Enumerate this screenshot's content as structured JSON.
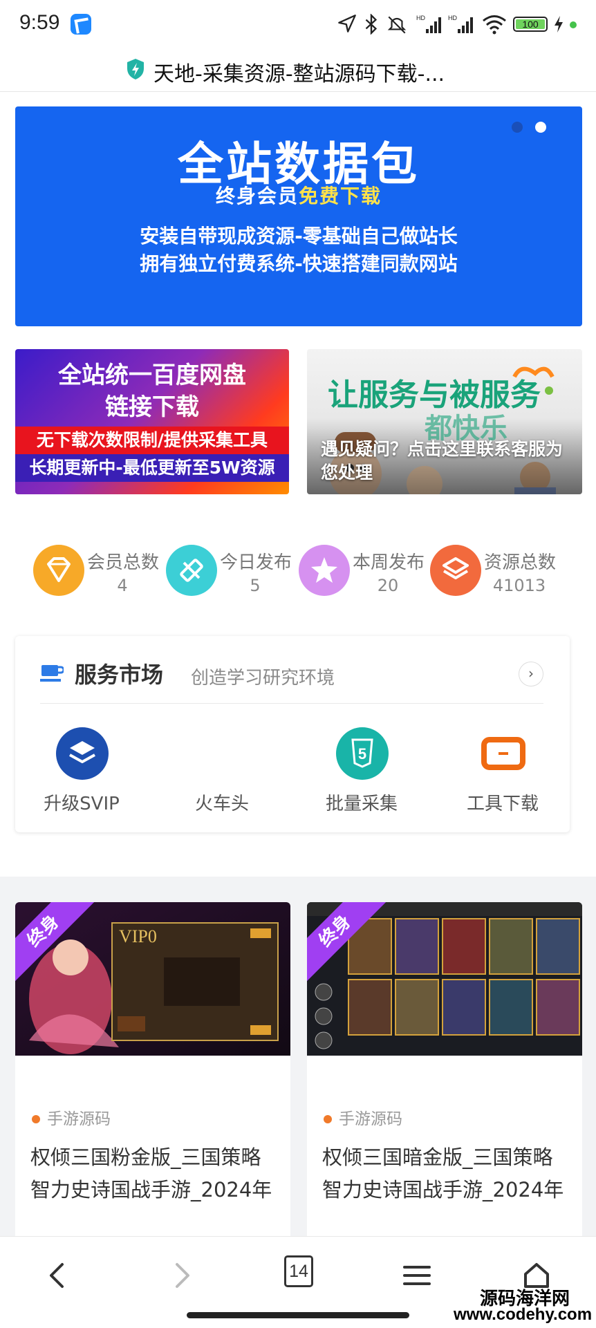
{
  "status_bar": {
    "time": "9:59",
    "battery": "100"
  },
  "address_bar": {
    "title": "天地-采集资源-整站源码下载-..."
  },
  "hero": {
    "title": "全站数据包",
    "subtitle_prefix": "终身会员",
    "subtitle_highlight": "免费下载",
    "line1": "安装自带现成资源-零基础自己做站长",
    "line2": "拥有独立付费系统-快速搭建同款网站"
  },
  "promo_left": {
    "title1": "全站统一百度网盘",
    "title2": "链接下载",
    "strip1": "无下载次数限制/提供采集工具",
    "strip2": "长期更新中-最低更新至5W资源"
  },
  "promo_right": {
    "title1": "让服务与被服务",
    "title2": "都快乐",
    "caption": "遇见疑问？点击这里联系客服为您处理"
  },
  "stats": [
    {
      "label": "会员总数",
      "value": "4",
      "color": "#f7a928",
      "icon": "diamond-icon"
    },
    {
      "label": "今日发布",
      "value": "5",
      "color": "#3ccfd6",
      "icon": "pencil-ruler-icon"
    },
    {
      "label": "本周发布",
      "value": "20",
      "color": "#d691f0",
      "icon": "star-icon"
    },
    {
      "label": "资源总数",
      "value": "41013",
      "color": "#f26a3d",
      "icon": "layers-icon"
    }
  ],
  "service": {
    "title": "服务市场",
    "subtitle": "创造学习研究环境",
    "items": [
      {
        "label": "升级SVIP",
        "icon": "layers-circle-icon"
      },
      {
        "label": "火车头",
        "icon": "train-icon"
      },
      {
        "label": "批量采集",
        "icon": "html5-icon"
      },
      {
        "label": "工具下载",
        "icon": "toolbox-icon"
      }
    ]
  },
  "posts": [
    {
      "ribbon": "终身",
      "tag": "手游源码",
      "title": "权倾三国粉金版_三国策略智力史诗国战手游_2024年",
      "image_text": "VIP0"
    },
    {
      "ribbon": "终身",
      "tag": "手游源码",
      "title": "权倾三国暗金版_三国策略智力史诗国战手游_2024年",
      "image_text": ""
    }
  ],
  "bottom_nav": {
    "tab_count": "14"
  },
  "watermark": {
    "line1": "源码海洋网",
    "line2": "www.codehy.com"
  }
}
